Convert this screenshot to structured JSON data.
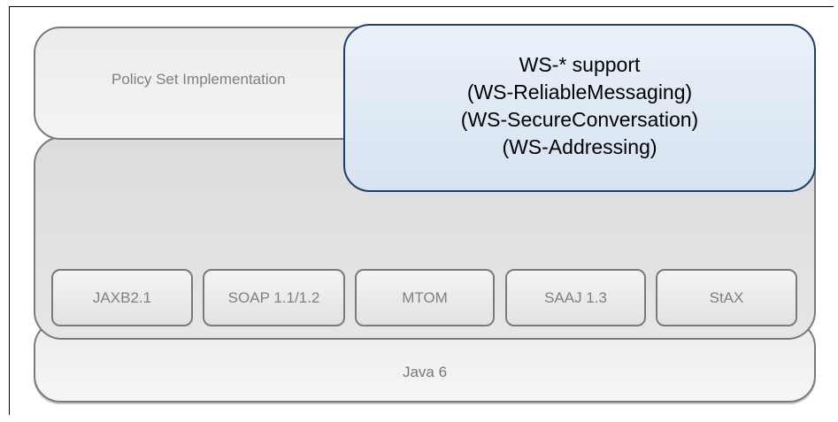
{
  "diagram": {
    "runtime_layer": {
      "label": "Java 6"
    },
    "policy_layer": {
      "label": "Policy Set Implementation"
    },
    "ws_support": {
      "lines": [
        "WS-* support",
        "(WS-ReliableMessaging)",
        "(WS-SecureConversation)",
        "(WS-Addressing)"
      ]
    },
    "components": [
      {
        "label": "JAXB2.1"
      },
      {
        "label": "SOAP 1.1/1.2"
      },
      {
        "label": "MTOM"
      },
      {
        "label": "SAAJ 1.3"
      },
      {
        "label": "StAX"
      }
    ]
  },
  "colors": {
    "ws_support_fill": "#dbe6f3",
    "ws_support_border": "#1f3e6a",
    "layer_fill": "#e0e0e0",
    "border": "#7a7a7a",
    "muted_text": "#808080"
  }
}
